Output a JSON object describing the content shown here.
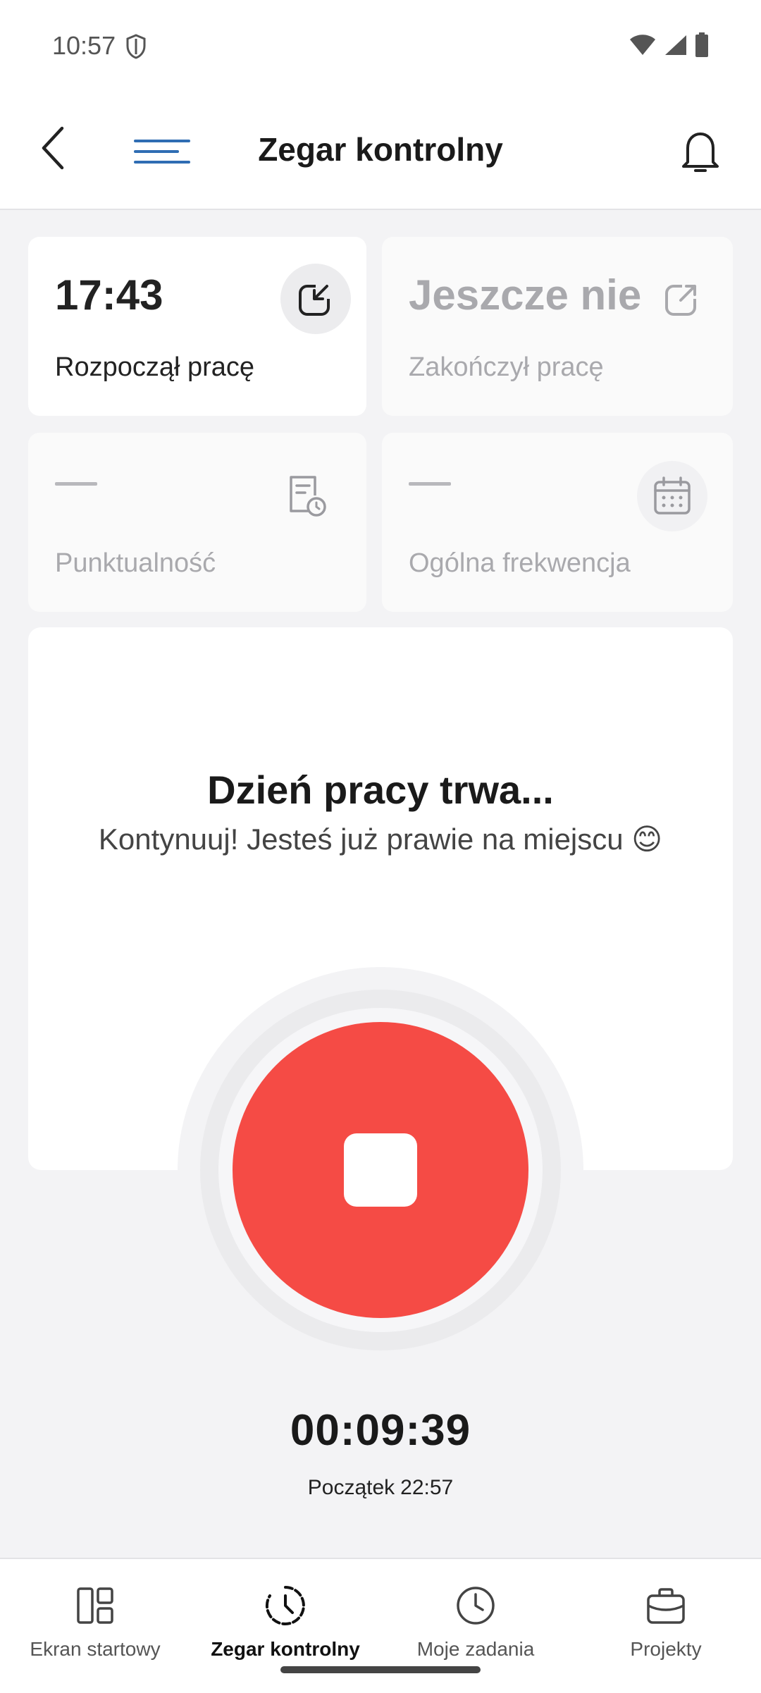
{
  "status_bar": {
    "time": "10:57"
  },
  "app_bar": {
    "title": "Zegar kontrolny"
  },
  "cards": {
    "start": {
      "value": "17:43",
      "label": "Rozpoczął pracę"
    },
    "end": {
      "value": "Jeszcze nie",
      "label": "Zakończył pracę"
    },
    "punctuality": {
      "value": "—",
      "label": "Punktualność"
    },
    "attendance": {
      "value": "—",
      "label": "Ogólna frekwencja"
    }
  },
  "main": {
    "title": "Dzień pracy trwa...",
    "subtitle": "Kontynuuj! Jesteś już prawie na miejscu 😊"
  },
  "timer": {
    "elapsed": "00:09:39",
    "start_label": "Początek",
    "start_time": "22:57"
  },
  "bottom_nav": [
    {
      "label": "Ekran startowy"
    },
    {
      "label": "Zegar kontrolny"
    },
    {
      "label": "Moje zadania"
    },
    {
      "label": "Projekty"
    }
  ],
  "colors": {
    "accent_blue": "#2f6db3",
    "stop_red": "#f54b45"
  }
}
